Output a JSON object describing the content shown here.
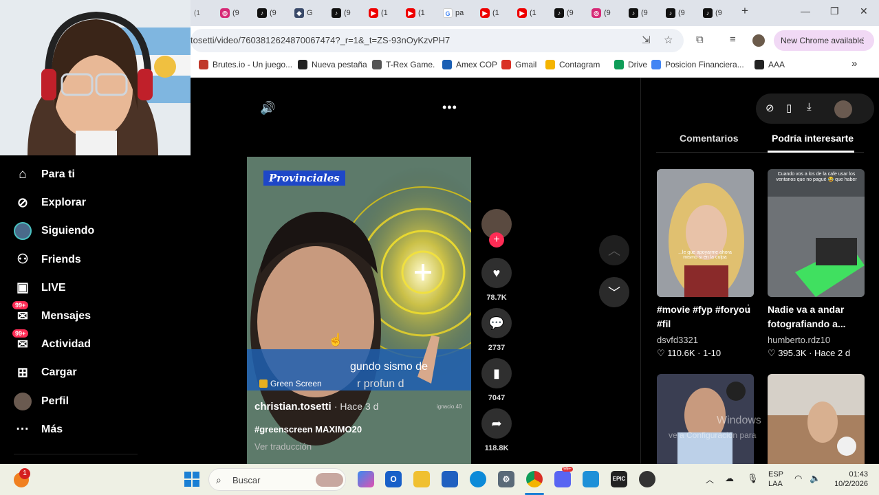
{
  "browser": {
    "tabs": [
      {
        "favicon": "insta",
        "label": "(9"
      },
      {
        "favicon": "tiktok",
        "label": "(9"
      },
      {
        "favicon": "gem",
        "label": "G"
      },
      {
        "favicon": "tiktok",
        "label": "(9"
      },
      {
        "favicon": "yt",
        "label": "(1"
      },
      {
        "favicon": "yt",
        "label": "(1"
      },
      {
        "favicon": "google",
        "label": "pa"
      },
      {
        "favicon": "yt",
        "label": "(1"
      },
      {
        "favicon": "yt",
        "label": "(1"
      },
      {
        "favicon": "tiktok",
        "label": "(9"
      },
      {
        "favicon": "insta",
        "label": "(9"
      },
      {
        "favicon": "tiktok",
        "label": "(9"
      },
      {
        "favicon": "tiktok",
        "label": "(9"
      },
      {
        "favicon": "tiktok",
        "label": "(9"
      }
    ],
    "first_tab_partial": "(1",
    "url": "tosetti/video/7603812624870067474?_r=1&_t=ZS-93nOyKzvPH7",
    "new_chrome_label": "New Chrome available",
    "bookmarks": [
      {
        "label": "Brutes.io - Un juego...",
        "color": "#c0392b"
      },
      {
        "label": "Nueva pestaña",
        "color": "#222222"
      },
      {
        "label": "T-Rex Game.",
        "color": "#555555"
      },
      {
        "label": "Amex COP",
        "color": "#1a5fb4"
      },
      {
        "label": "Gmail",
        "color": "#d93025"
      },
      {
        "label": "Contagram",
        "color": "#f4b400"
      },
      {
        "label": "Drive",
        "color": "#0f9d58"
      },
      {
        "label": "Posicion Financiera...",
        "color": "#4285f4"
      },
      {
        "label": "AAA",
        "color": "#222222"
      }
    ],
    "more_bookmarks": "»"
  },
  "sidebar": {
    "items": [
      {
        "label": "Para ti",
        "icon": "home-icon"
      },
      {
        "label": "Explorar",
        "icon": "compass-icon"
      },
      {
        "label": "Siguiendo",
        "icon": "following-avatar"
      },
      {
        "label": "Friends",
        "icon": "friends-icon"
      },
      {
        "label": "LIVE",
        "icon": "live-icon"
      },
      {
        "label": "Mensajes",
        "icon": "messages-icon",
        "badge": "99+"
      },
      {
        "label": "Actividad",
        "icon": "activity-icon",
        "badge": "99+"
      },
      {
        "label": "Cargar",
        "icon": "upload-icon"
      },
      {
        "label": "Perfil",
        "icon": "profile-avatar"
      },
      {
        "label": "Más",
        "icon": "more-icon"
      }
    ]
  },
  "video": {
    "category_label": "Provinciales",
    "caption_overlay": "gundo sismo de",
    "caption_overlay_2": "r profun d",
    "effect_label": "Green Screen",
    "username": "christian.tosetti",
    "time": "· Hace 3 d",
    "hashtags": "#greenscreen MAXIMO20",
    "translate": "Ver traducción",
    "watermark": "ignacio.40"
  },
  "actions": {
    "likes": "78.7K",
    "comments": "2737",
    "saves": "7047",
    "shares": "118.8K"
  },
  "right_panel": {
    "tabs": [
      "Comentarios",
      "Podría interesarte"
    ],
    "active_tab": 1,
    "cards": [
      {
        "title": "#movie #fyp #foryou #fil",
        "user": "dsvfd3321",
        "likes": "110.6K",
        "extra": "1-10",
        "thumb_caption": "...le que apoyarme ahora mismo si en la culpa"
      },
      {
        "title": "Nadie va a andar fotografiando a...",
        "user": "humberto.rdz10",
        "likes": "395.3K",
        "extra": "Hace 2 d",
        "thumb_caption": "Cuando vos a los de la cafe usar los ventanos que no pagué 😂 que haber"
      },
      {
        "title": "",
        "user": "",
        "likes": "",
        "extra": "",
        "thumb_caption": ""
      },
      {
        "title": "",
        "user": "",
        "likes": "",
        "extra": "",
        "thumb_caption": ""
      }
    ],
    "activate_windows": "Windows",
    "activate_windows_2": "ve a Configuración para"
  },
  "taskbar": {
    "search_placeholder": "Buscar",
    "notification_count": "1",
    "lang": "ESP",
    "lang_2": "LAA",
    "time": "01:43",
    "date": "10/2/2026",
    "discord_badge": "99+"
  },
  "colors": {
    "tiktok_red": "#fe2c55",
    "chrome_tab_bg": "#dfe3ea",
    "taskbar_bg": "#eef0e4"
  }
}
